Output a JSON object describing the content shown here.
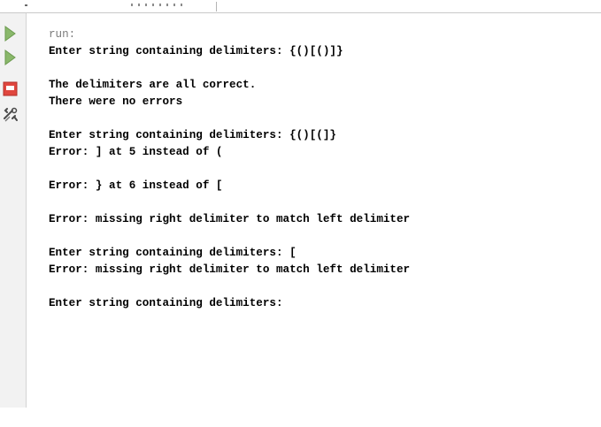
{
  "colors": {
    "run_arrow": "#8ab86b",
    "stop": "#e0463e",
    "console_text": "#000000",
    "run_label": "#7c7c7c",
    "gutter_bg": "#f2f2f2"
  },
  "gutter": {
    "icons": [
      "run-icon",
      "rerun-icon",
      "stop-icon",
      "settings-icon"
    ]
  },
  "console": {
    "lines": [
      "run:",
      "Enter string containing delimiters: {()[()]}",
      "",
      "The delimiters are all correct.",
      "There were no errors",
      "",
      "Enter string containing delimiters: {()[(]}",
      "Error: ] at 5 instead of (",
      "",
      "Error: } at 6 instead of [",
      "",
      "Error: missing right delimiter to match left delimiter",
      "",
      "Enter string containing delimiters: [",
      "Error: missing right delimiter to match left delimiter",
      "",
      "Enter string containing delimiters:"
    ]
  }
}
